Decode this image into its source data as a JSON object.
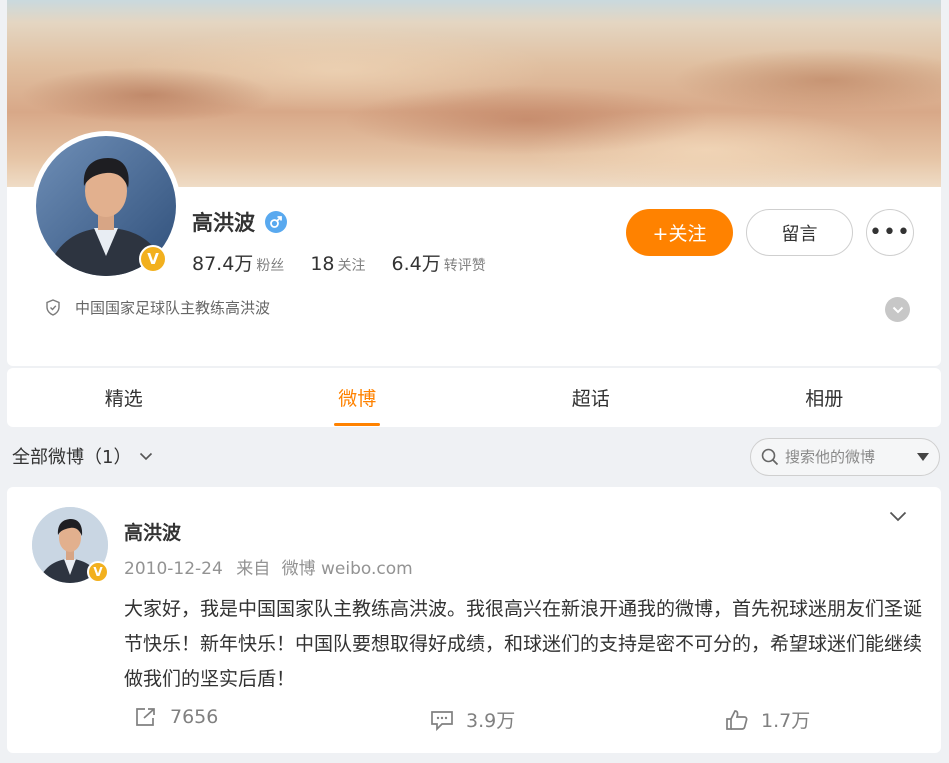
{
  "profile": {
    "name": "高洪波",
    "verified_badge": "V",
    "gender_icon": "male-icon",
    "stats": [
      {
        "value": "87.4万",
        "label": "粉丝"
      },
      {
        "value": "18",
        "label": "关注"
      },
      {
        "value": "6.4万",
        "label": "转评赞"
      }
    ],
    "follow_label": "+关注",
    "message_label": "留言",
    "more_label": "•••",
    "description": "中国国家足球队主教练高洪波"
  },
  "tabs": [
    {
      "label": "精选",
      "active": false
    },
    {
      "label": "微博",
      "active": true
    },
    {
      "label": "超话",
      "active": false
    },
    {
      "label": "相册",
      "active": false
    }
  ],
  "filter": {
    "label": "全部微博（1）",
    "search_placeholder": "搜索他的微博"
  },
  "post": {
    "author": "高洪波",
    "verified_badge": "V",
    "date": "2010-12-24",
    "source_prefix": "来自",
    "source": "微博 weibo.com",
    "text": "大家好，我是中国国家队主教练高洪波。我很高兴在新浪开通我的微博，首先祝球迷朋友们圣诞节快乐！新年快乐！中国队要想取得好成绩，和球迷们的支持是密不可分的，希望球迷们能继续做我们的坚实后盾！",
    "reposts": "7656",
    "comments": "3.9万",
    "likes": "1.7万"
  },
  "colors": {
    "accent": "#ff8200",
    "verified": "#f2b01e",
    "gender": "#59a9ef"
  }
}
